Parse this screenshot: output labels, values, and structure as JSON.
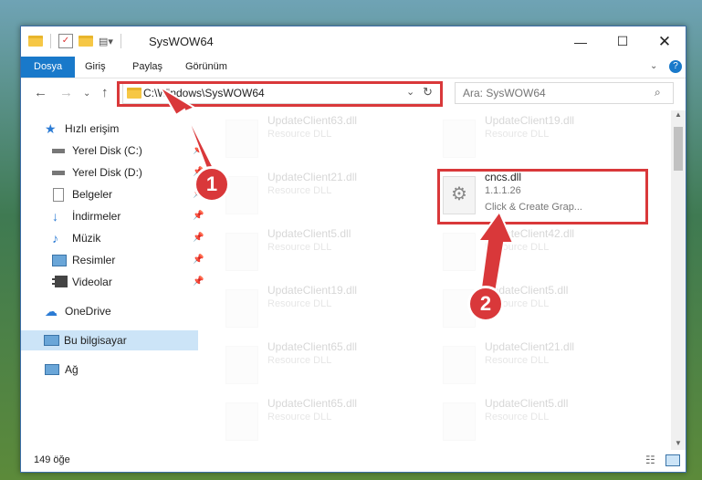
{
  "window": {
    "title": "SysWOW64"
  },
  "ribbon": {
    "tabs": [
      "Dosya",
      "Giriş",
      "Paylaş",
      "Görünüm"
    ]
  },
  "nav": {
    "address": "C:\\Windows\\SysWOW64",
    "search_placeholder": "Ara: SysWOW64"
  },
  "sidebar": {
    "quick_access": "Hızlı erişim",
    "items": [
      {
        "label": "Yerel Disk (C:)"
      },
      {
        "label": "Yerel Disk (D:)"
      },
      {
        "label": "Belgeler"
      },
      {
        "label": "İndirmeler"
      },
      {
        "label": "Müzik"
      },
      {
        "label": "Resimler"
      },
      {
        "label": "Videolar"
      }
    ],
    "onedrive": "OneDrive",
    "this_pc": "Bu bilgisayar",
    "network": "Ağ"
  },
  "files": [
    {
      "name": "UpdateClient63.dll",
      "type": "Resource DLL"
    },
    {
      "name": "UpdateClient19.dll",
      "type": "Resource DLL"
    },
    {
      "name": "UpdateClient21.dll",
      "type": "Resource DLL"
    },
    {
      "name": "cncs.dll",
      "version": "1.1.1.26",
      "description": "Click & Create Grap..."
    },
    {
      "name": "UpdateClient5.dll",
      "type": "Resource DLL"
    },
    {
      "name": "UpdateClient42.dll",
      "type": "Resource DLL"
    },
    {
      "name": "UpdateClient19.dll",
      "type": "Resource DLL"
    },
    {
      "name": "UpdateClient5.dll",
      "type": "Resource DLL"
    },
    {
      "name": "UpdateClient65.dll",
      "type": "Resource DLL"
    },
    {
      "name": "UpdateClient21.dll",
      "type": "Resource DLL"
    },
    {
      "name": "UpdateClient65.dll",
      "type": "Resource DLL"
    },
    {
      "name": "UpdateClient5.dll",
      "type": "Resource DLL"
    }
  ],
  "status": {
    "count": "149 öğe"
  },
  "annotations": {
    "step1": "1",
    "step2": "2",
    "color": "#d9383a"
  }
}
